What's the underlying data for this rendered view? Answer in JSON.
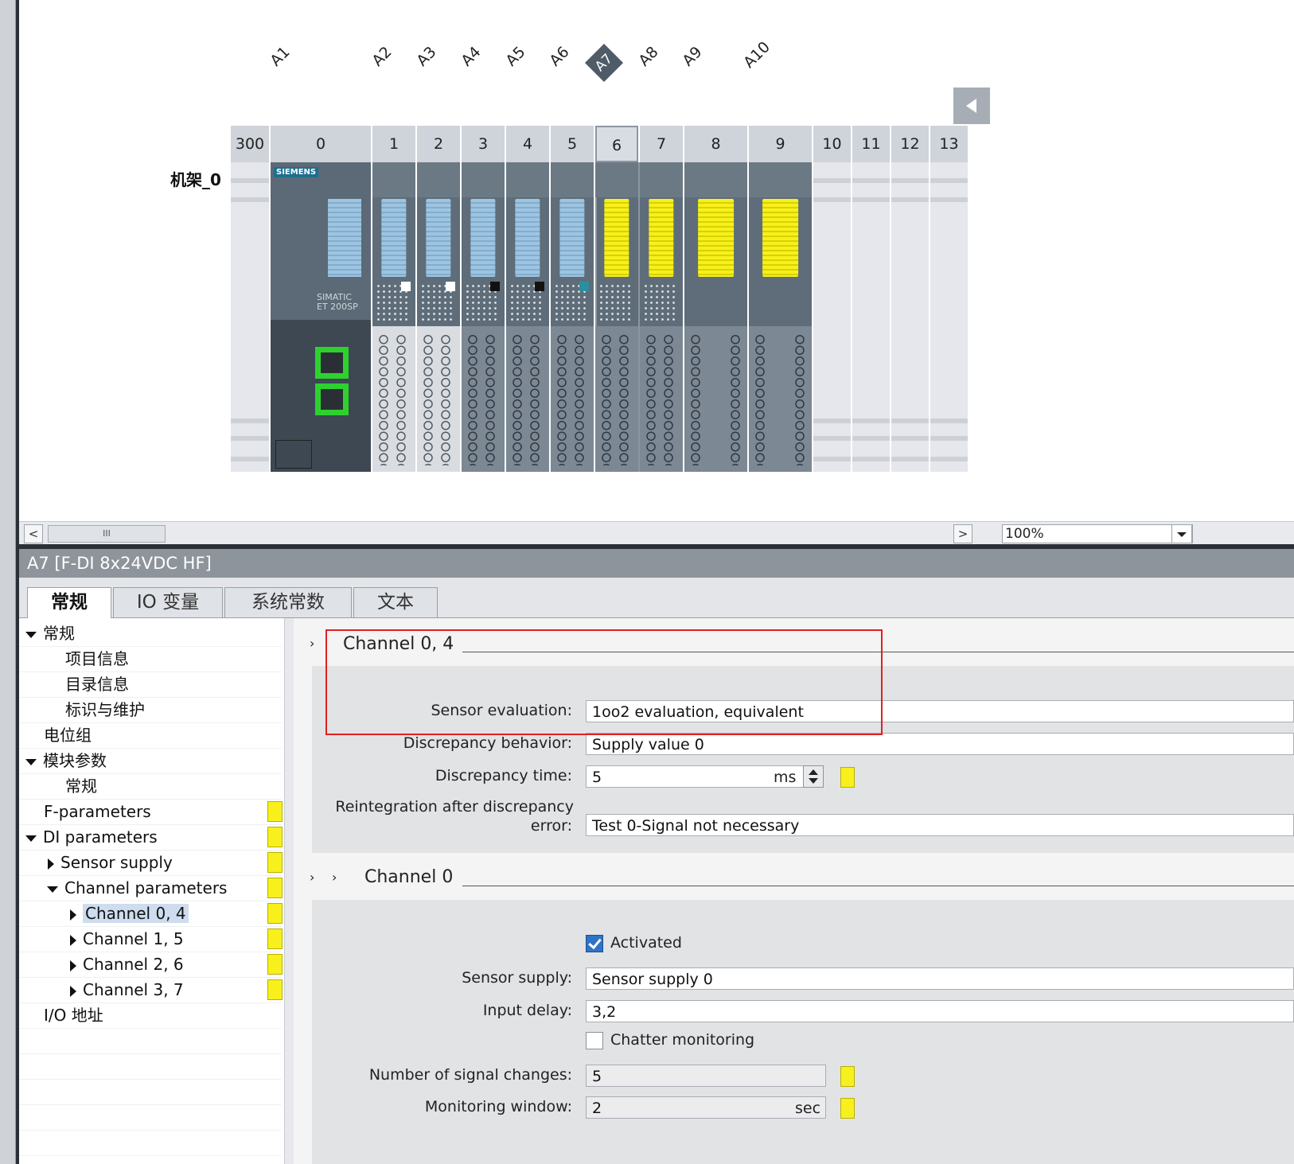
{
  "device_view": {
    "address_labels": [
      "A1",
      "A2",
      "A3",
      "A4",
      "A5",
      "A6",
      "A7",
      "A8",
      "A9",
      "A10"
    ],
    "rack_label": "机架_0",
    "slots": [
      "300",
      "0",
      "1",
      "2",
      "3",
      "4",
      "5",
      "6",
      "7",
      "8",
      "9",
      "10",
      "11",
      "12",
      "13"
    ],
    "interface_module": {
      "brand": "SIEMENS",
      "name": "SIMATIC\nET 200SP"
    }
  },
  "scrollbar": {
    "left_arrow": "<",
    "right_arrow": ">",
    "thumb": "III",
    "zoom": "100%"
  },
  "properties": {
    "title": "A7 [F-DI 8x24VDC HF]",
    "tabs": [
      "常规",
      "IO 变量",
      "系统常数",
      "文本"
    ],
    "nav": [
      {
        "label": "常规"
      },
      {
        "label": "项目信息"
      },
      {
        "label": "目录信息"
      },
      {
        "label": "标识与维护"
      },
      {
        "label": "电位组"
      },
      {
        "label": "模块参数"
      },
      {
        "label": "常规"
      },
      {
        "label": "F-parameters"
      },
      {
        "label": "DI parameters"
      },
      {
        "label": "Sensor supply"
      },
      {
        "label": "Channel parameters"
      },
      {
        "label": "Channel 0, 4"
      },
      {
        "label": "Channel 1, 5"
      },
      {
        "label": "Channel 2, 6"
      },
      {
        "label": "Channel 3, 7"
      },
      {
        "label": "I/O 地址"
      }
    ],
    "channel04": {
      "header": "Channel 0, 4",
      "sensor_evaluation_label": "Sensor evaluation:",
      "sensor_evaluation_value": "1oo2 evaluation, equivalent",
      "discrepancy_behavior_label": "Discrepancy behavior:",
      "discrepancy_behavior_value": "Supply value 0",
      "discrepancy_time_label": "Discrepancy time:",
      "discrepancy_time_value": "5",
      "discrepancy_time_unit": "ms",
      "reintegration_label_1": "Reintegration after discrepancy",
      "reintegration_label_2": "error:",
      "reintegration_value": "Test 0-Signal not necessary"
    },
    "channel0": {
      "header": "Channel 0",
      "activated_label": "Activated",
      "sensor_supply_label": "Sensor supply:",
      "sensor_supply_value": "Sensor supply 0",
      "input_delay_label": "Input delay:",
      "input_delay_value": "3,2",
      "chatter_label": "Chatter monitoring",
      "signal_changes_label": "Number of signal changes:",
      "signal_changes_value": "5",
      "monitoring_window_label": "Monitoring window:",
      "monitoring_window_value": "2",
      "monitoring_window_unit": "sec"
    },
    "expand_glyph": "›"
  }
}
